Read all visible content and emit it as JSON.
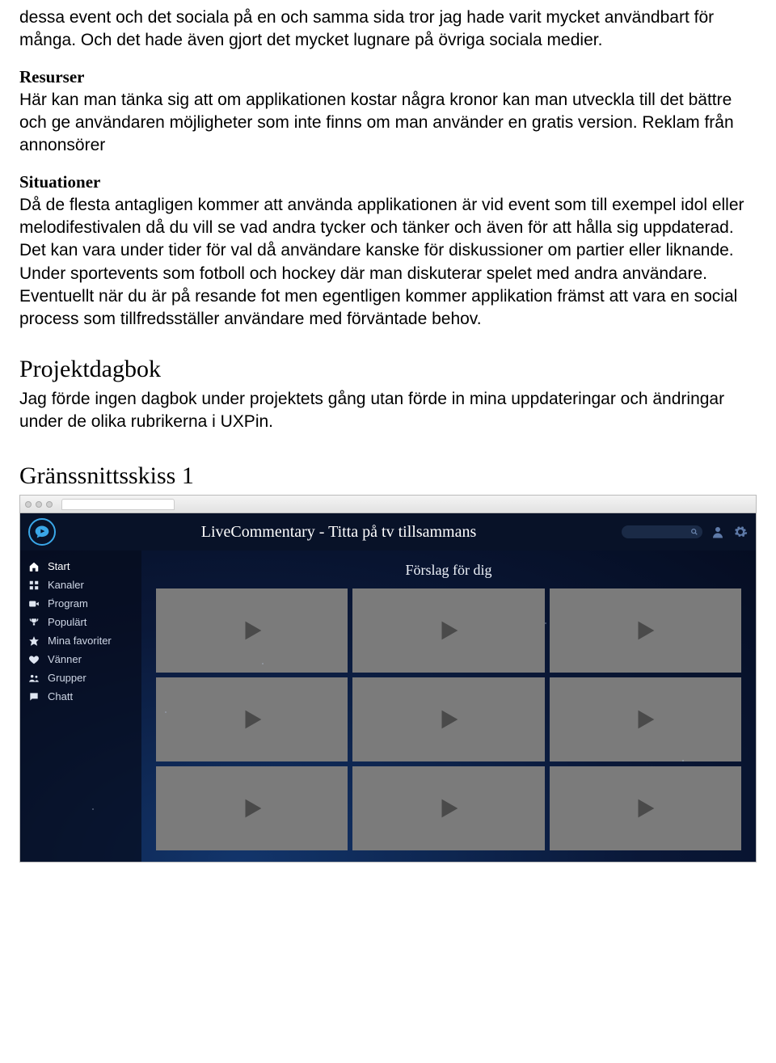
{
  "paragraphs": {
    "intro": "dessa event och det sociala på en och samma sida tror jag hade varit mycket användbart för många. Och det hade även gjort det mycket lugnare på övriga sociala medier.",
    "resurser_heading": "Resurser",
    "resurser_body": "Här kan man tänka sig att om applikationen kostar några kronor kan man utveckla till det bättre och ge användaren möjligheter som inte finns om man använder en gratis version. Reklam från annonsörer",
    "situationer_heading": "Situationer",
    "situationer_body": "Då de flesta antagligen kommer att använda applikationen är vid event som till exempel idol eller melodifestivalen då du vill se vad andra tycker och tänker och även för att hålla sig uppdaterad. Det kan vara under tider för val då användare kanske för diskussioner om partier eller liknande. Under sportevents som fotboll och hockey där man diskuterar spelet med andra användare. Eventuellt när du är på resande fot men egentligen kommer applikation främst att vara en social process som tillfredsställer användare med förväntade behov.",
    "projektdagbok_heading": "Projektdagbok",
    "projektdagbok_body": "Jag förde ingen dagbok under projektets gång utan förde in mina uppdateringar och ändringar under de olika rubrikerna i UXPin.",
    "skiss_heading": "Gränssnittsskiss 1"
  },
  "mockup": {
    "app_title": "LiveCommentary - Titta på tv tillsammans",
    "suggestion_title": "Förslag för dig",
    "sidebar": [
      {
        "label": "Start",
        "icon": "home-icon",
        "active": true
      },
      {
        "label": "Kanaler",
        "icon": "grid-icon",
        "active": false
      },
      {
        "label": "Program",
        "icon": "video-icon",
        "active": false
      },
      {
        "label": "Populärt",
        "icon": "trophy-icon",
        "active": false
      },
      {
        "label": "Mina favoriter",
        "icon": "star-icon",
        "active": false
      },
      {
        "label": "Vänner",
        "icon": "heart-icon",
        "active": false
      },
      {
        "label": "Grupper",
        "icon": "users-icon",
        "active": false
      },
      {
        "label": "Chatt",
        "icon": "chat-icon",
        "active": false
      }
    ],
    "tiles_count": 9
  }
}
